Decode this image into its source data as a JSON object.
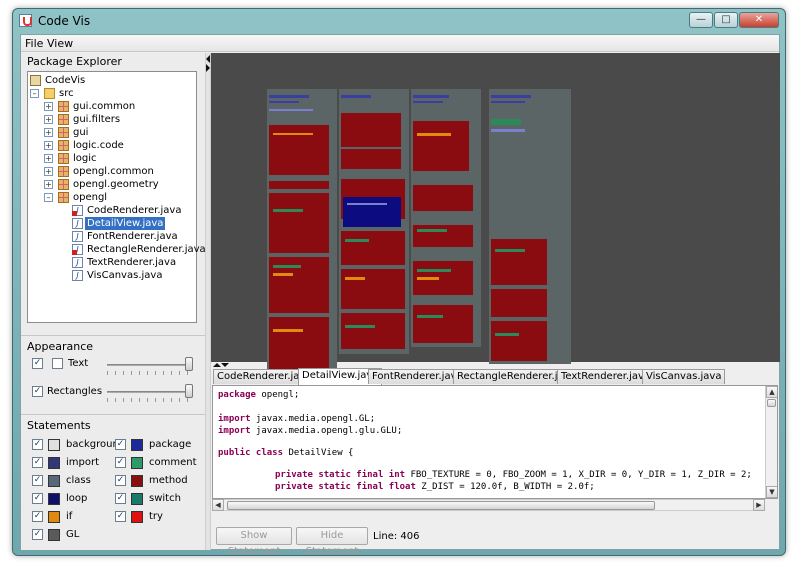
{
  "window": {
    "title": "Code Vis"
  },
  "menubar": {
    "items": [
      "File",
      "View"
    ]
  },
  "package_explorer": {
    "title": "Package Explorer",
    "tree": [
      {
        "label": "CodeVis",
        "kind": "project"
      },
      {
        "label": "src",
        "kind": "folder"
      },
      {
        "label": "gui.common",
        "kind": "package"
      },
      {
        "label": "gui.filters",
        "kind": "package"
      },
      {
        "label": "gui",
        "kind": "package"
      },
      {
        "label": "logic.code",
        "kind": "package"
      },
      {
        "label": "logic",
        "kind": "package"
      },
      {
        "label": "opengl.common",
        "kind": "package"
      },
      {
        "label": "opengl.geometry",
        "kind": "package"
      },
      {
        "label": "opengl",
        "kind": "package"
      },
      {
        "label": "CodeRenderer.java",
        "kind": "java-error"
      },
      {
        "label": "DetailView.java",
        "kind": "java",
        "selected": true
      },
      {
        "label": "FontRenderer.java",
        "kind": "java"
      },
      {
        "label": "RectangleRenderer.java",
        "kind": "java-error"
      },
      {
        "label": "TextRenderer.java",
        "kind": "java"
      },
      {
        "label": "VisCanvas.java",
        "kind": "java"
      }
    ]
  },
  "appearance": {
    "title": "Appearance",
    "text_label": "Text",
    "rectangles_label": "Rectangles",
    "text_slider_level": 1.0,
    "rectangles_slider_level": 1.0
  },
  "statements": {
    "title": "Statements",
    "items": [
      {
        "label": "background",
        "color": "#e0e0e0"
      },
      {
        "label": "package",
        "color": "#1a2a9a"
      },
      {
        "label": "import",
        "color": "#303878"
      },
      {
        "label": "comment",
        "color": "#2c9a6a"
      },
      {
        "label": "class",
        "color": "#586878"
      },
      {
        "label": "method",
        "color": "#8a1010"
      },
      {
        "label": "loop",
        "color": "#10106a"
      },
      {
        "label": "switch",
        "color": "#1a7a6a"
      },
      {
        "label": "if",
        "color": "#e08a10"
      },
      {
        "label": "try",
        "color": "#e01010"
      },
      {
        "label": "GL",
        "color": "#5a5a5a"
      }
    ]
  },
  "tabs": [
    "CodeRenderer.java",
    "DetailView.java",
    "FontRenderer.java",
    "RectangleRenderer.java",
    "TextRenderer.java",
    "VisCanvas.java"
  ],
  "active_tab": "DetailView.java",
  "code": {
    "l1_kw": "package",
    "l1_rest": " opengl;",
    "l2_kw": "import",
    "l2_rest": " javax.media.opengl.GL;",
    "l3_kw": "import",
    "l3_rest": " javax.media.opengl.glu.GLU;",
    "l4_kw": "public class",
    "l4_rest": " DetailView {",
    "l5_kw": "private static final int",
    "l5_rest": " FBO_TEXTURE = 0, FBO_ZOOM = 1, X_DIR = 0, Y_DIR = 1, Z_DIR = 2;",
    "l6_kw": "private static final float",
    "l6_rest": " Z_DIST = 120.0f, B_WIDTH = 2.0f;"
  },
  "buttons": {
    "show_statement": "Show Statement",
    "hide_statement": "Hide Statement"
  },
  "status": {
    "line": "Line: 406"
  }
}
